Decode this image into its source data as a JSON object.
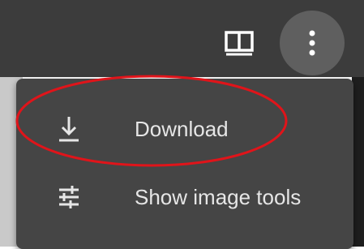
{
  "toolbar": {
    "split_view_icon": "split-view-icon",
    "more_icon": "more-vert-icon"
  },
  "menu": {
    "items": [
      {
        "label": "Download",
        "icon": "download-icon"
      },
      {
        "label": "Show image tools",
        "icon": "tune-icon"
      }
    ]
  },
  "colors": {
    "toolbar_bg": "#3c3c3c",
    "menu_bg": "#454545",
    "more_button_bg": "#5f5f5f",
    "text": "#e6e6e6",
    "annotation": "#e0141a"
  }
}
